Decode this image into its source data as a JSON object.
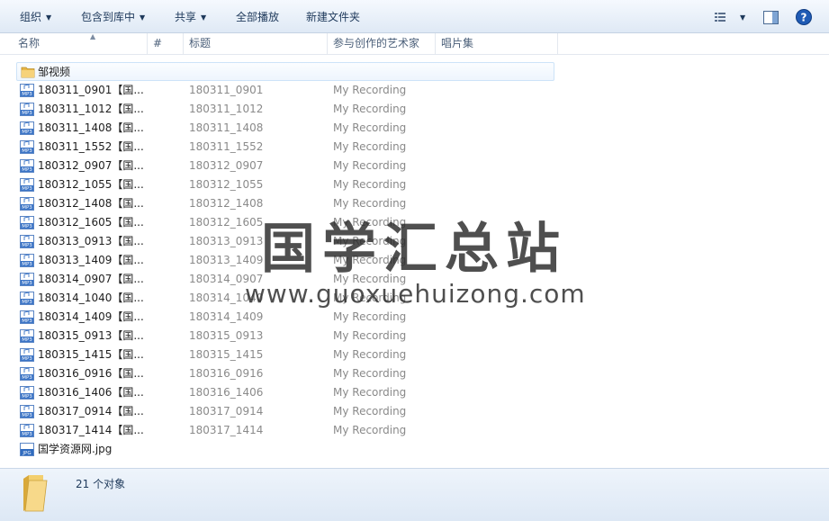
{
  "toolbar": {
    "organize": "组织",
    "include_library": "包含到库中",
    "share": "共享",
    "play_all": "全部播放",
    "new_folder": "新建文件夹",
    "view_icon": "view-list-icon",
    "preview_icon": "preview-pane-icon",
    "help_icon": "help-icon"
  },
  "columns": {
    "name": "名称",
    "number": "#",
    "title": "标题",
    "artist": "参与创作的艺术家",
    "album": "唱片集"
  },
  "folder": {
    "name": "邹视频"
  },
  "files": [
    {
      "name": "180311_0901【国...",
      "title": "180311_0901",
      "artist": "My Recording"
    },
    {
      "name": "180311_1012【国...",
      "title": "180311_1012",
      "artist": "My Recording"
    },
    {
      "name": "180311_1408【国...",
      "title": "180311_1408",
      "artist": "My Recording"
    },
    {
      "name": "180311_1552【国...",
      "title": "180311_1552",
      "artist": "My Recording"
    },
    {
      "name": "180312_0907【国...",
      "title": "180312_0907",
      "artist": "My Recording"
    },
    {
      "name": "180312_1055【国...",
      "title": "180312_1055",
      "artist": "My Recording"
    },
    {
      "name": "180312_1408【国...",
      "title": "180312_1408",
      "artist": "My Recording"
    },
    {
      "name": "180312_1605【国...",
      "title": "180312_1605",
      "artist": "My Recording"
    },
    {
      "name": "180313_0913【国...",
      "title": "180313_0913",
      "artist": "My Recording"
    },
    {
      "name": "180313_1409【国...",
      "title": "180313_1409",
      "artist": "My Recording"
    },
    {
      "name": "180314_0907【国...",
      "title": "180314_0907",
      "artist": "My Recording"
    },
    {
      "name": "180314_1040【国...",
      "title": "180314_1040",
      "artist": "My Recording"
    },
    {
      "name": "180314_1409【国...",
      "title": "180314_1409",
      "artist": "My Recording"
    },
    {
      "name": "180315_0913【国...",
      "title": "180315_0913",
      "artist": "My Recording"
    },
    {
      "name": "180315_1415【国...",
      "title": "180315_1415",
      "artist": "My Recording"
    },
    {
      "name": "180316_0916【国...",
      "title": "180316_0916",
      "artist": "My Recording"
    },
    {
      "name": "180316_1406【国...",
      "title": "180316_1406",
      "artist": "My Recording"
    },
    {
      "name": "180317_0914【国...",
      "title": "180317_0914",
      "artist": "My Recording"
    },
    {
      "name": "180317_1414【国...",
      "title": "180317_1414",
      "artist": "My Recording"
    }
  ],
  "image_file": {
    "name": "国学资源网.jpg"
  },
  "watermark": {
    "title": "国学汇总站",
    "url": "www.guoxuehuizong.com"
  },
  "status": {
    "count_text": "21 个对象"
  },
  "colors": {
    "toolbar_text": "#1e395b",
    "header_text": "#4c607a",
    "secondary_text": "#8a8a8a"
  }
}
